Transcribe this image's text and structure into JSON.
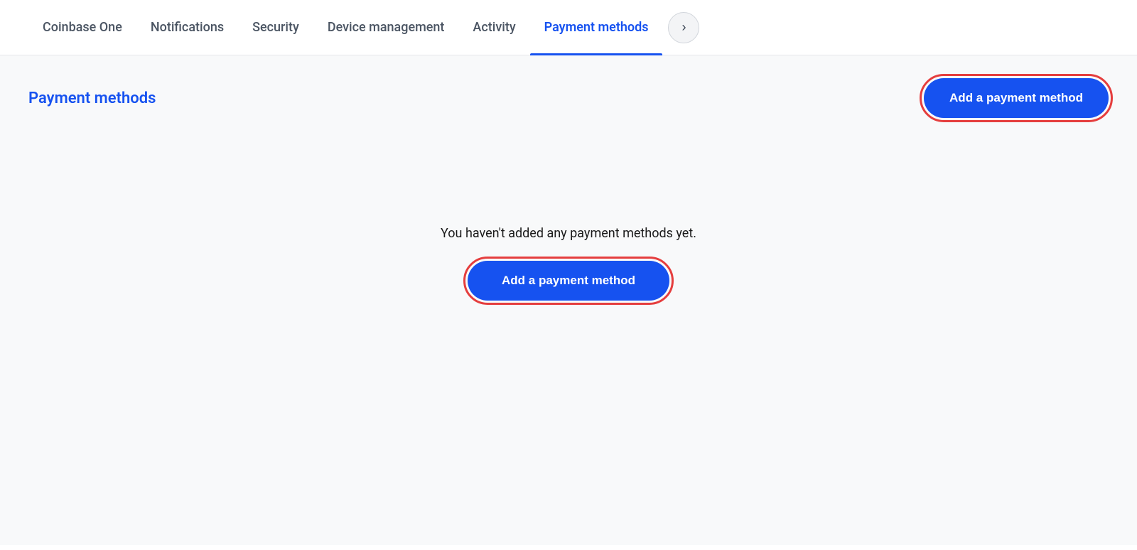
{
  "nav": {
    "tabs": [
      {
        "id": "coinbase-one",
        "label": "Coinbase One",
        "active": false
      },
      {
        "id": "notifications",
        "label": "Notifications",
        "active": false
      },
      {
        "id": "security",
        "label": "Security",
        "active": false
      },
      {
        "id": "device-management",
        "label": "Device management",
        "active": false
      },
      {
        "id": "activity",
        "label": "Activity",
        "active": false
      },
      {
        "id": "payment-methods",
        "label": "Payment methods",
        "active": true
      }
    ],
    "more_button_label": "›"
  },
  "main": {
    "page_title": "Payment methods",
    "add_button_label": "Add a payment method",
    "empty_state_text": "You haven't added any payment methods yet.",
    "add_button_center_label": "Add a payment method"
  },
  "colors": {
    "active_tab": "#1652f0",
    "button_bg": "#1652f0",
    "button_text": "#ffffff",
    "highlight_outline": "#e53e3e"
  }
}
